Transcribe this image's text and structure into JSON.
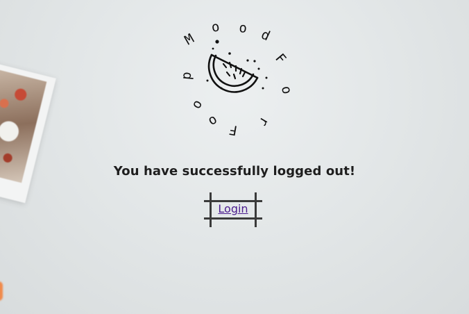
{
  "logo": {
    "ring_text": "FoodMoodFor",
    "letters": [
      "F",
      "o",
      "o",
      "d",
      "M",
      "o",
      "o",
      "d",
      "F",
      "o",
      "r"
    ],
    "icon": "watermelon-slice-icon"
  },
  "message": "You have successfully logged out!",
  "login": {
    "label": "Login"
  },
  "colors": {
    "background": "#e3e7e8",
    "text": "#1e1e1e",
    "link": "#4b1c8e",
    "frame": "#3a3a3a"
  }
}
